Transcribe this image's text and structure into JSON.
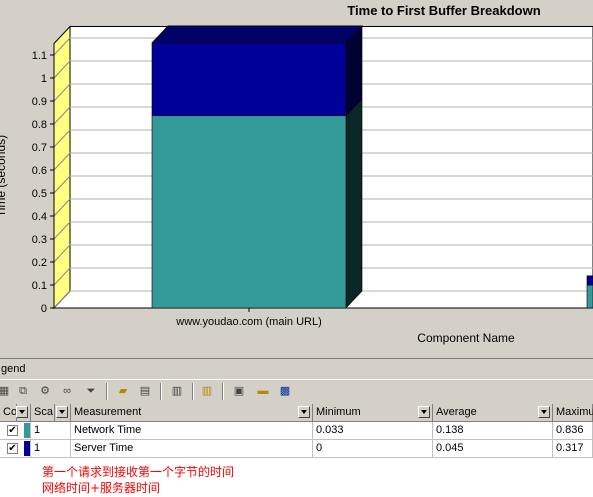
{
  "chart_data": {
    "type": "bar",
    "title": "Time to First Buffer Breakdown",
    "xlabel": "Component Name",
    "ylabel": "Time (seconds)",
    "ylim": [
      0,
      1.15
    ],
    "yticks": [
      0,
      0.1,
      0.2,
      0.3,
      0.4,
      0.5,
      0.6,
      0.7,
      0.8,
      0.9,
      1,
      1.1
    ],
    "stacked": true,
    "categories": [
      "www.youdao.com (main URL)"
    ],
    "series": [
      {
        "name": "Network Time",
        "color": "#339999",
        "values": [
          0.836
        ]
      },
      {
        "name": "Server Time",
        "color": "#000099",
        "values": [
          0.317
        ]
      }
    ],
    "grid": true
  },
  "legend": {
    "label": "gend"
  },
  "table": {
    "columns": [
      {
        "key": "col",
        "label": "Col"
      },
      {
        "key": "scale",
        "label": "Sca"
      },
      {
        "key": "measurement",
        "label": "Measurement"
      },
      {
        "key": "minimum",
        "label": "Minimum"
      },
      {
        "key": "average",
        "label": "Average"
      },
      {
        "key": "maximum",
        "label": "Maximu"
      }
    ],
    "rows": [
      {
        "checked": true,
        "color": "#339999",
        "scale": "1",
        "measurement": "Network Time",
        "minimum": "0.033",
        "average": "0.138",
        "maximum": "0.836"
      },
      {
        "checked": true,
        "color": "#000099",
        "scale": "1",
        "measurement": "Server Time",
        "minimum": "0",
        "average": "0.045",
        "maximum": "0.317"
      }
    ]
  },
  "notes": {
    "line1": "第一个请求到接收第一个字节的时间",
    "line2": "网络时间+服务器时间"
  },
  "icons": [
    "filter-icon",
    "group-icon",
    "configure-icon",
    "link-icon",
    "funnel-icon",
    "open-folder-icon",
    "export-icon",
    "print-icon",
    "columns-icon",
    "copy-icon",
    "ruler-icon",
    "save-icon"
  ]
}
